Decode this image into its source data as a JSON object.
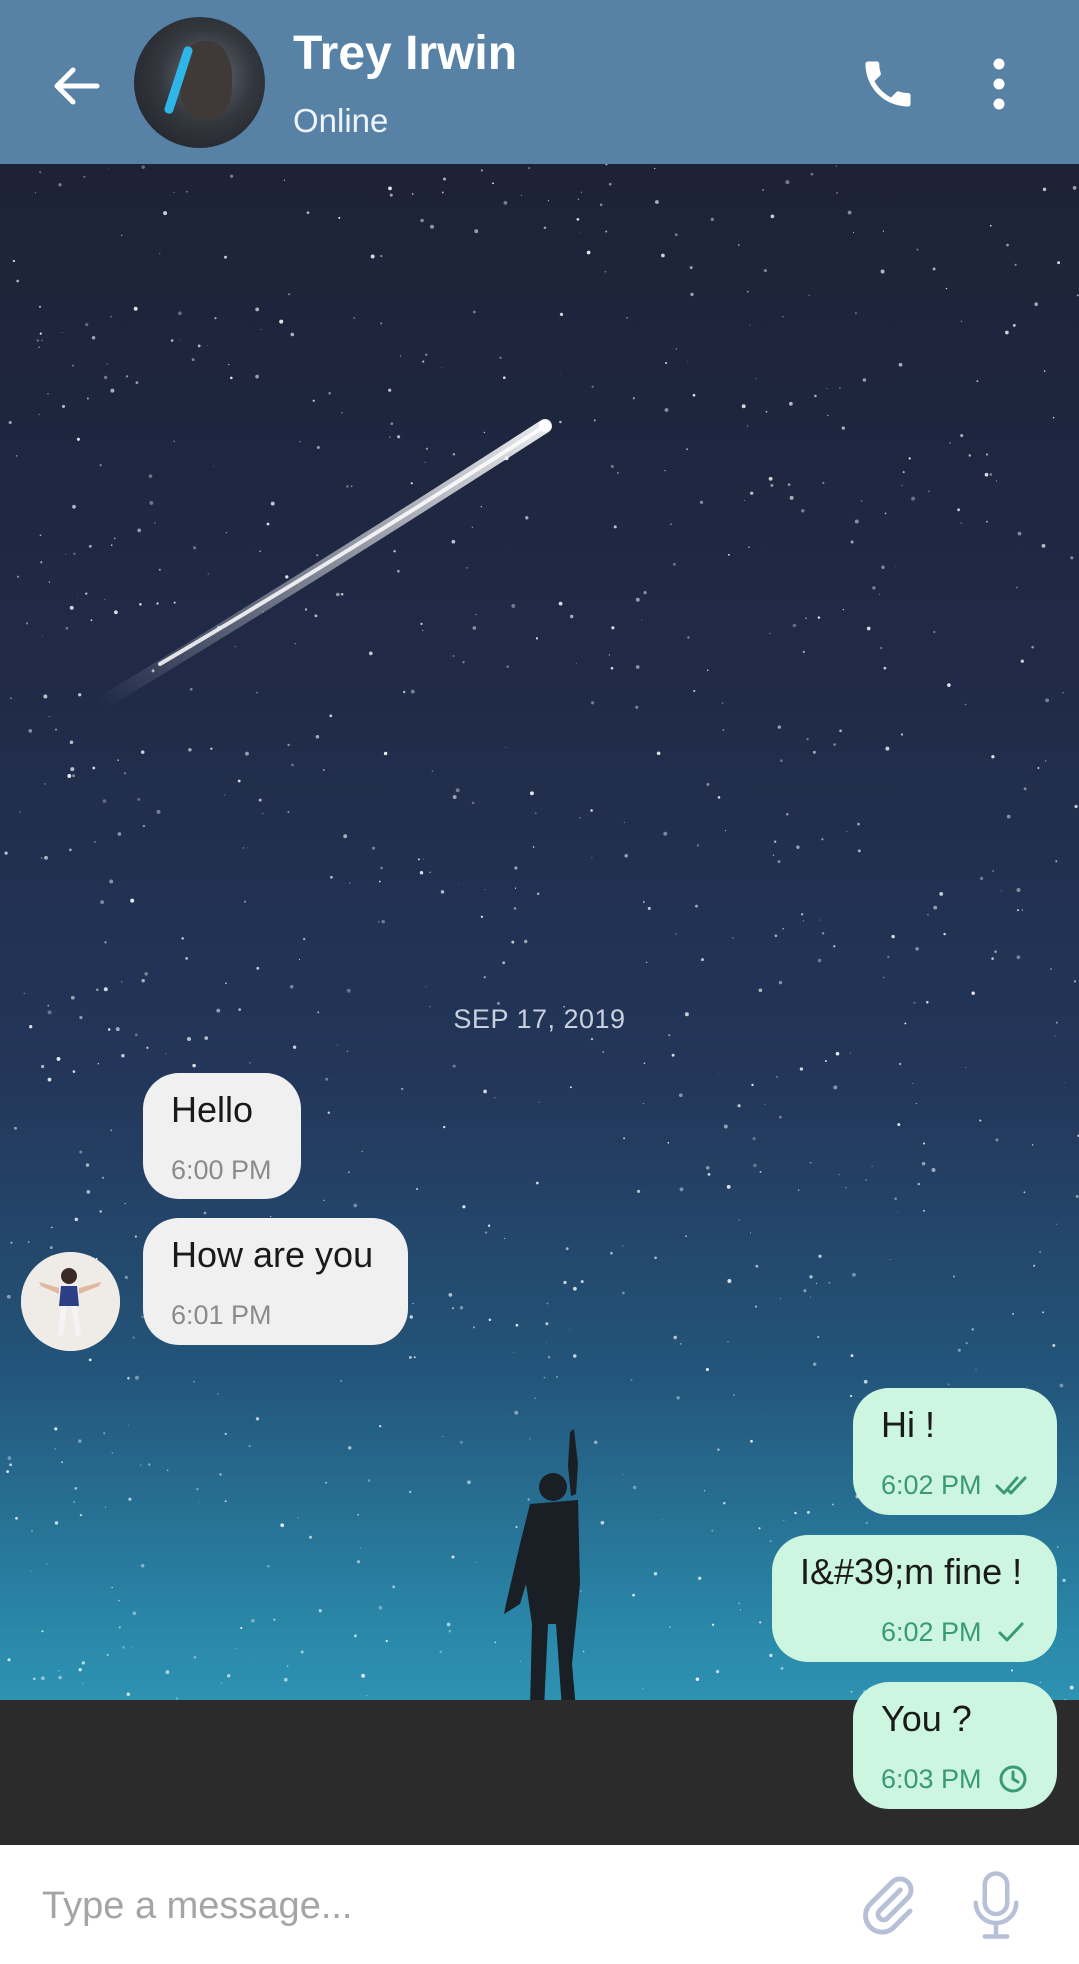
{
  "header": {
    "contact_name": "Trey Irwin",
    "status": "Online",
    "icons": {
      "back": "arrow-back-icon",
      "call": "phone-icon",
      "menu": "more-vert-icon"
    },
    "color": "#5782a6"
  },
  "chat": {
    "date": "SEP 17, 2019",
    "incoming": [
      {
        "text": "Hello",
        "time": "6:00 PM"
      },
      {
        "text": "How are you",
        "time": "6:01 PM"
      }
    ],
    "outgoing": [
      {
        "text": "Hi !",
        "time": "6:02 PM",
        "status": "read"
      },
      {
        "text": "I&#39;m fine !",
        "time": "6:02 PM",
        "status": "sent"
      },
      {
        "text": "You ?",
        "time": "6:03 PM",
        "status": "pending"
      }
    ],
    "colors": {
      "incoming_bubble": "#f0f0f0",
      "outgoing_bubble": "#cdf6e0",
      "outgoing_time": "#3a9a72"
    }
  },
  "composer": {
    "placeholder": "Type a message...",
    "icons": {
      "attach": "paperclip-icon",
      "mic": "microphone-icon"
    }
  }
}
